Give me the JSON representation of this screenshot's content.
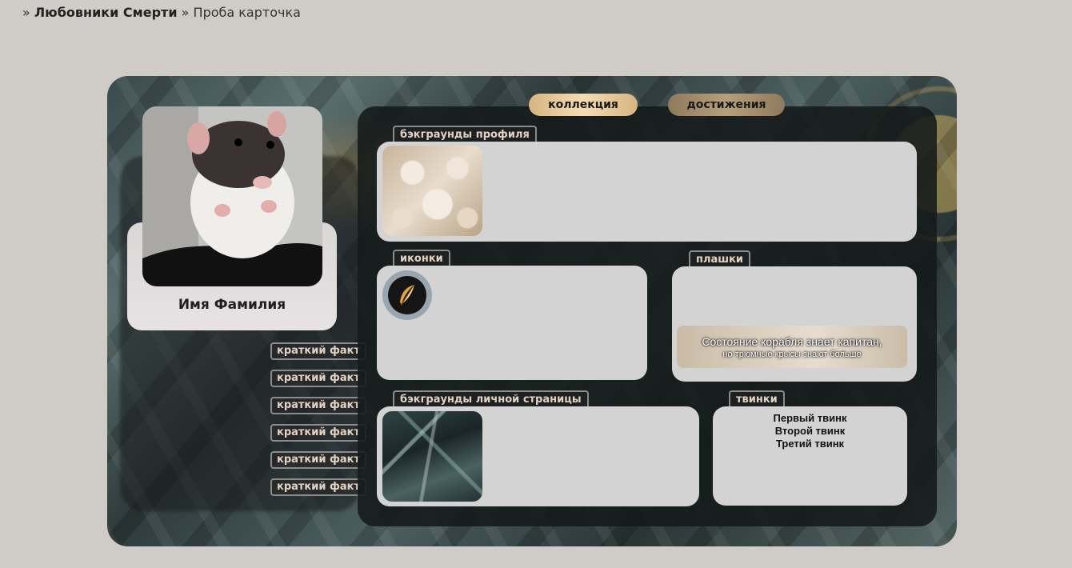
{
  "breadcrumb": {
    "sep1": "»",
    "forum": "Любовники Смерти",
    "sep2": "»",
    "page": "Проба карточка"
  },
  "profile": {
    "name": "Имя Фамилия",
    "avatar_icon": "rat-photo",
    "facts": [
      "краткий факт",
      "краткий факт",
      "краткий факт",
      "краткий факт",
      "краткий факт",
      "краткий факт"
    ]
  },
  "tabs": {
    "collection": "коллекция",
    "achievements": "достижения"
  },
  "sections": {
    "profile_bg": "бэкграунды профиля",
    "icons": "иконки",
    "plaques": "плашки",
    "page_bg": "бэкграунды личной страницы",
    "twinks": "твинки"
  },
  "plaque": {
    "line1": "Состояние корабля знает капитан,",
    "line2": "но трюмные крысы знают больше"
  },
  "twinks": [
    "Первый твинк",
    "Второй твинк",
    "Третий твинк"
  ],
  "colors": {
    "page_bg": "#cfccc7",
    "label_text": "#e2d2c2",
    "box_bg": "#d3d3d3",
    "tab_gold": "#f5ddb0"
  }
}
